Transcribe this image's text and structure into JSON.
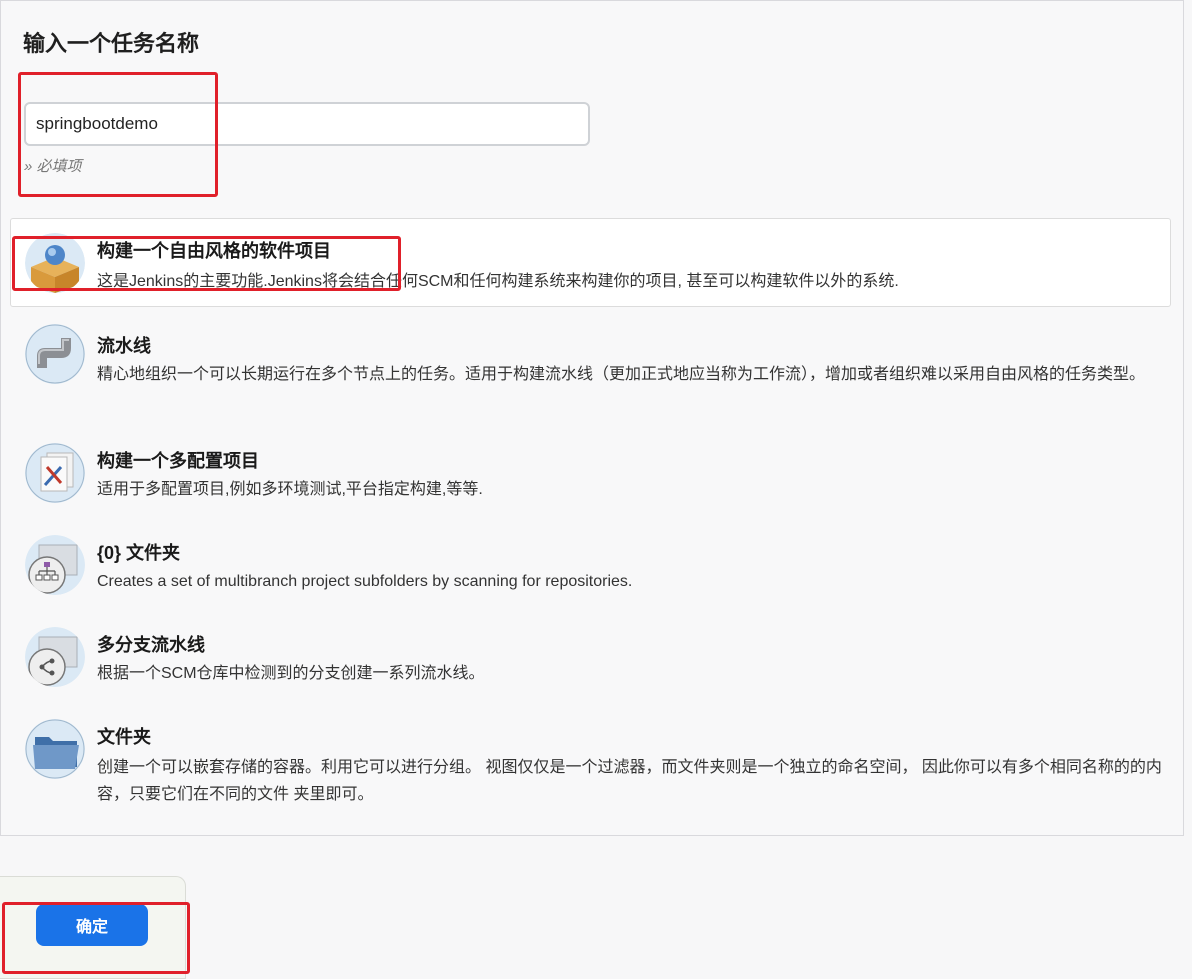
{
  "header": {
    "title": "输入一个任务名称"
  },
  "name_field": {
    "value": "springbootdemo",
    "required_hint": "» 必填项"
  },
  "item_types": [
    {
      "name": "构建一个自由风格的软件项目",
      "description": "这是Jenkins的主要功能.Jenkins将会结合任何SCM和任何构建系统来构建你的项目, 甚至可以构建软件以外的系统.",
      "icon": "freestyle-box-icon",
      "selected": true
    },
    {
      "name": "流水线",
      "description": "精心地组织一个可以长期运行在多个节点上的任务。适用于构建流水线（更加正式地应当称为工作流），增加或者组织难以采用自由风格的任务类型。",
      "icon": "pipeline-icon",
      "selected": false
    },
    {
      "name": "构建一个多配置项目",
      "description": "适用于多配置项目,例如多环境测试,平台指定构建,等等.",
      "icon": "multi-config-icon",
      "selected": false
    },
    {
      "name": "{0} 文件夹",
      "description": "Creates a set of multibranch project subfolders by scanning for repositories.",
      "icon": "org-folder-icon",
      "selected": false
    },
    {
      "name": "多分支流水线",
      "description": "根据一个SCM仓库中检测到的分支创建一系列流水线。",
      "icon": "multibranch-pipeline-icon",
      "selected": false
    },
    {
      "name": "文件夹",
      "description": "创建一个可以嵌套存储的容器。利用它可以进行分组。 视图仅仅是一个过滤器，而文件夹则是一个独立的命名空间， 因此你可以有多个相同名称的的内容，只要它们在不同的文件 夹里即可。",
      "icon": "folder-icon",
      "selected": false
    }
  ],
  "footer": {
    "ok_label": "确定"
  },
  "colors": {
    "accent": "#1a73e8",
    "highlight": "#e0202a"
  }
}
